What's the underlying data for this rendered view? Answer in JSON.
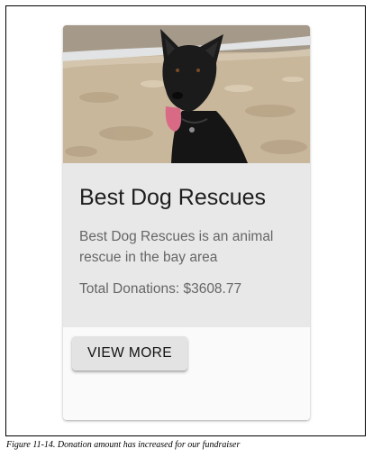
{
  "card": {
    "image_subject": "black-dog-photo",
    "title": "Best Dog Rescues",
    "description": "Best Dog Rescues is an animal rescue in the bay area",
    "total_donations": "Total Donations: $3608.77",
    "button_label": "VIEW MORE"
  },
  "caption": "Figure 11-14. Donation amount has increased for our fundraiser",
  "colors": {
    "content_bg": "#e8e8e8",
    "button_bg": "#e3e3e3",
    "title_color": "#1d1d1d",
    "body_text": "#666666"
  }
}
